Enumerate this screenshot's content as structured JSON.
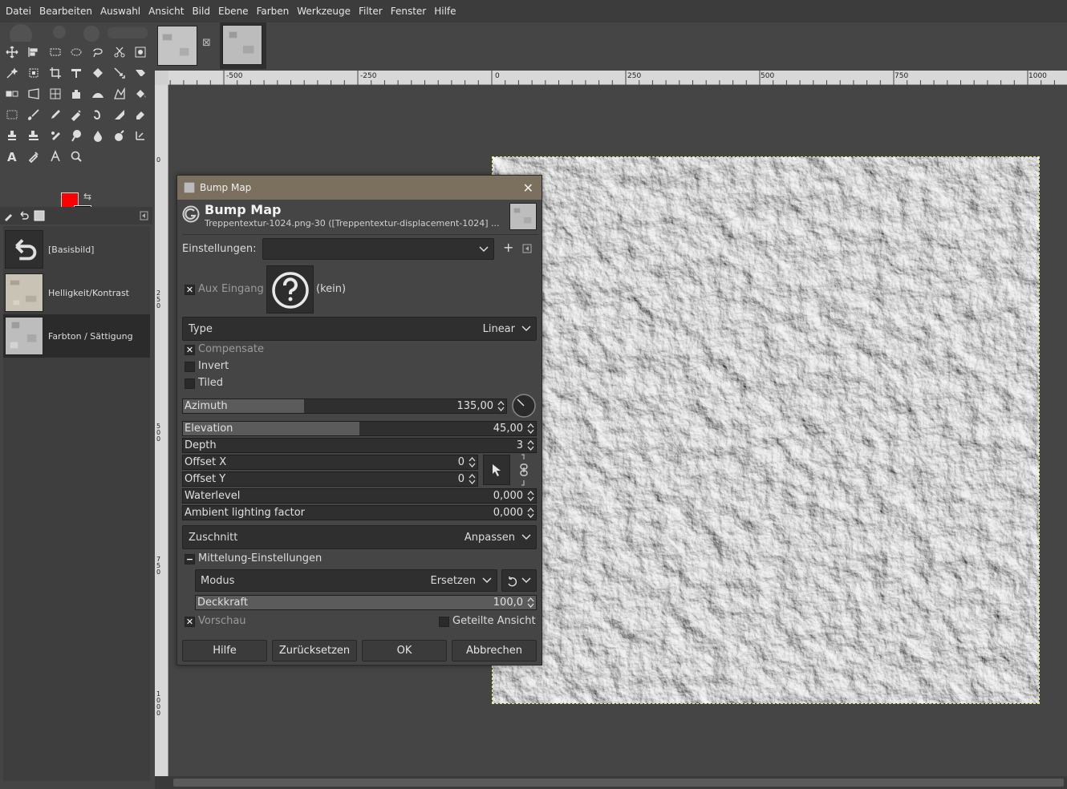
{
  "menubar": {
    "items": [
      "Datei",
      "Bearbeiten",
      "Auswahl",
      "Ansicht",
      "Bild",
      "Ebene",
      "Farben",
      "Werkzeuge",
      "Filter",
      "Fenster",
      "Hilfe"
    ]
  },
  "colors": {
    "foreground": "#ff0000",
    "background": "#000000",
    "dialog_title_bar": "#7b6f5d",
    "selection_border": "#e8e880"
  },
  "layers": [
    {
      "name": "[Basisbild]"
    },
    {
      "name": "Helligkeit/Kontrast"
    },
    {
      "name": "Farbton / Sättigung"
    }
  ],
  "ruler": {
    "h_labels": [
      "-500",
      "-250",
      "0",
      "250",
      "500",
      "750",
      "1000"
    ],
    "v_labels": [
      "0",
      "250",
      "500",
      "750",
      "1000"
    ]
  },
  "dialog": {
    "window_title": "Bump Map",
    "heading": "Bump Map",
    "subtitle": "Treppentextur-1024.png-30 ([Treppentextur-displacement-1024] ...",
    "presets_label": "Einstellungen:",
    "presets_value": "",
    "aux_label": "Aux Eingang",
    "aux_value": "(kein)",
    "type_label": "Type",
    "type_value": "Linear",
    "compensate_label": "Compensate",
    "invert_label": "Invert",
    "tiled_label": "Tiled",
    "azimuth": {
      "label": "Azimuth",
      "value": "135,00",
      "fraction": 0.375
    },
    "elevation": {
      "label": "Elevation",
      "value": "45,00",
      "fraction": 0.5
    },
    "depth": {
      "label": "Depth",
      "value": "3"
    },
    "offset_x": {
      "label": "Offset X",
      "value": "0"
    },
    "offset_y": {
      "label": "Offset Y",
      "value": "0"
    },
    "waterlevel": {
      "label": "Waterlevel",
      "value": "0,000"
    },
    "ambient": {
      "label": "Ambient lighting factor",
      "value": "0,000"
    },
    "clipping_label": "Zuschnitt",
    "clipping_value": "Anpassen",
    "blending_label": "Mittelung-Einstellungen",
    "mode_label": "Modus",
    "mode_value": "Ersetzen",
    "opacity": {
      "label": "Deckkraft",
      "value": "100,0",
      "fraction": 1.0
    },
    "preview_label": "Vorschau",
    "split_view_label": "Geteilte Ansicht",
    "buttons": {
      "help": "Hilfe",
      "reset": "Zurücksetzen",
      "ok": "OK",
      "cancel": "Abbrechen"
    }
  }
}
